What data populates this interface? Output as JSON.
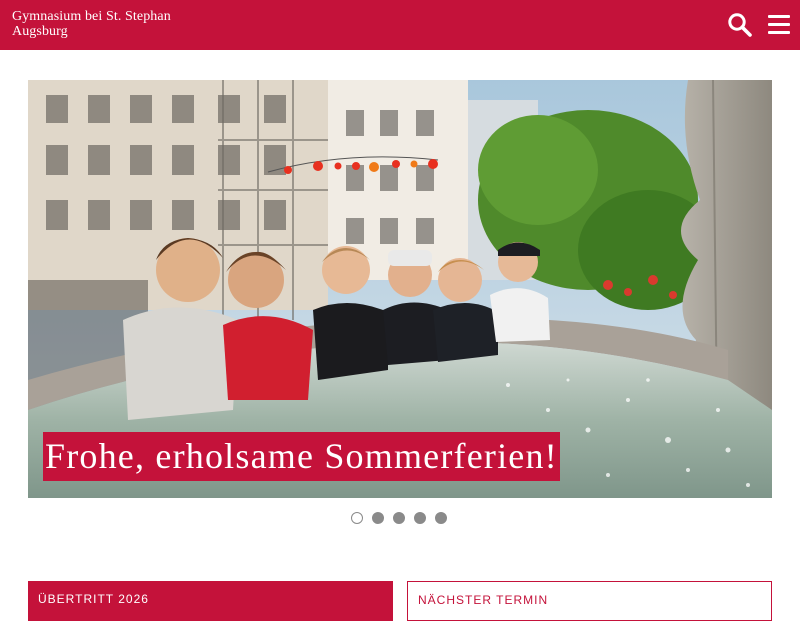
{
  "header": {
    "logo_line1": "Gymnasium bei St. Stephan",
    "logo_line2": "Augsburg",
    "search_icon": "search-icon",
    "menu_icon": "hamburger-menu-icon",
    "brand_color": "#c4123a"
  },
  "slider": {
    "caption": "Frohe, erholsame Sommerferien!",
    "slide_count": 5,
    "active_slide": 1
  },
  "boxes": {
    "left_title": "ÜBERTRITT 2026",
    "right_title": "NÄCHSTER TERMIN"
  }
}
